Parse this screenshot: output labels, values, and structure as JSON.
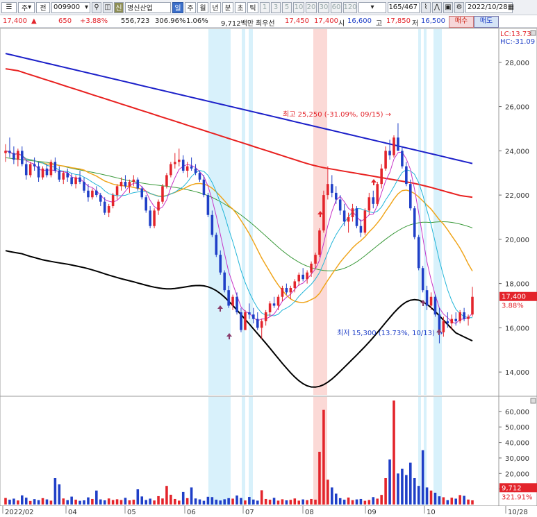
{
  "toolbar": {
    "market": "주",
    "mode": "전",
    "code": "009900",
    "badge": "신",
    "name": "명신산업",
    "periods": [
      "일",
      "주",
      "월",
      "년",
      "분",
      "초",
      "틱"
    ],
    "selected_period": "일",
    "intervals": [
      "1",
      "3",
      "5",
      "10",
      "20",
      "30",
      "60",
      "120"
    ],
    "count": "165",
    "total": "/467",
    "date": "2022/10/28"
  },
  "info": {
    "price": "17,400",
    "change": "650",
    "change_pct": "+3.88%",
    "volume": "556,723",
    "volume_ratio": "306.96%",
    "turnover": "1.06%",
    "amount": "9,712백만",
    "best_quote_label": "최우선",
    "best_ask": "17,450",
    "best_bid": "17,400",
    "open_label": "시",
    "open": "16,600",
    "high_label": "고",
    "high": "17,850",
    "low_label": "저",
    "low": "16,500",
    "buy": "매수",
    "sell": "매도"
  },
  "colors": {
    "up": "#e3242b",
    "down": "#1f3fc7",
    "ma_short": "#c733c7",
    "ma_mid": "#22b5d8",
    "ma_20": "#f0a51c",
    "ma_60": "#3b9a3b",
    "ma_120": "#e8201f",
    "ma_240": "#1c20c9",
    "envelope": "#000000"
  },
  "chart_data": {
    "type": "candlestick",
    "y_axis": {
      "ticks": [
        "28,000",
        "26,000",
        "24,000",
        "22,000",
        "20,000",
        "18,000",
        "16,000",
        "14,000"
      ],
      "range": [
        13000,
        29500
      ]
    },
    "x_axis": {
      "labels": [
        "2022/02",
        "04",
        "05",
        "06",
        "07",
        "08",
        "09",
        "10",
        "10/28"
      ]
    },
    "lc": "LC:13.73",
    "hc": "HC:-31.09",
    "high_annotation": "최고 25,250 (-31.09%, 09/15)",
    "low_annotation": "최저 15,300 (13.73%, 10/13)",
    "last_price": "17,400",
    "last_change": "3.88%",
    "volume_axis": {
      "ticks": [
        "60,000",
        "50,000",
        "40,000",
        "30,000",
        "20,000",
        "10,000"
      ],
      "range": [
        0,
        68000
      ]
    },
    "last_volume": "9,712",
    "last_volume_ratio": "321.91%",
    "candles": [
      [
        23900,
        24300,
        23500,
        24000
      ],
      [
        24000,
        24600,
        23700,
        23900
      ],
      [
        23900,
        24200,
        23400,
        23600
      ],
      [
        23600,
        24100,
        23300,
        24000
      ],
      [
        24000,
        24200,
        23300,
        23400
      ],
      [
        23400,
        23600,
        22700,
        22900
      ],
      [
        22900,
        23500,
        22800,
        23400
      ],
      [
        23400,
        23700,
        23100,
        23300
      ],
      [
        23300,
        23500,
        22600,
        22800
      ],
      [
        22800,
        23300,
        22700,
        23200
      ],
      [
        23200,
        23400,
        22800,
        22900
      ],
      [
        22900,
        23600,
        22800,
        23500
      ],
      [
        23500,
        23700,
        23000,
        23100
      ],
      [
        23100,
        23300,
        22600,
        22700
      ],
      [
        22700,
        23100,
        22500,
        23000
      ],
      [
        23000,
        23200,
        22600,
        22800
      ],
      [
        22800,
        23000,
        22400,
        22500
      ],
      [
        22500,
        22900,
        22300,
        22800
      ],
      [
        22800,
        23100,
        22500,
        22600
      ],
      [
        22600,
        22800,
        22100,
        22200
      ],
      [
        22200,
        22500,
        21700,
        21900
      ],
      [
        21900,
        22300,
        21800,
        22200
      ],
      [
        22200,
        22400,
        21900,
        22000
      ],
      [
        22000,
        22100,
        21500,
        21700
      ],
      [
        21700,
        21900,
        21100,
        21200
      ],
      [
        21200,
        21600,
        21000,
        21500
      ],
      [
        21500,
        22100,
        21400,
        22000
      ],
      [
        22000,
        22500,
        21800,
        22400
      ],
      [
        22400,
        22800,
        22200,
        22600
      ],
      [
        22600,
        22900,
        22300,
        22400
      ],
      [
        22400,
        22700,
        22100,
        22600
      ],
      [
        22600,
        22900,
        22400,
        22700
      ],
      [
        22700,
        22800,
        22200,
        22300
      ],
      [
        22300,
        22400,
        21800,
        21900
      ],
      [
        21900,
        22000,
        21200,
        21300
      ],
      [
        21300,
        21500,
        20500,
        20600
      ],
      [
        20600,
        21400,
        20500,
        21300
      ],
      [
        21300,
        21800,
        21100,
        21700
      ],
      [
        21700,
        22500,
        21600,
        22400
      ],
      [
        22400,
        23000,
        22300,
        22900
      ],
      [
        22900,
        23500,
        22800,
        23400
      ],
      [
        23400,
        23900,
        23200,
        23500
      ],
      [
        23500,
        24100,
        23300,
        23600
      ],
      [
        23600,
        23800,
        23000,
        23100
      ],
      [
        23100,
        23500,
        22800,
        23300
      ],
      [
        23300,
        23700,
        23100,
        23200
      ],
      [
        23200,
        23400,
        22900,
        23000
      ],
      [
        23000,
        23100,
        22600,
        22700
      ],
      [
        22700,
        22900,
        21900,
        22000
      ],
      [
        22000,
        22100,
        21000,
        21100
      ],
      [
        21100,
        21300,
        20100,
        20200
      ],
      [
        20200,
        20300,
        19200,
        19300
      ],
      [
        19300,
        19500,
        18400,
        18500
      ],
      [
        18500,
        18600,
        17600,
        17700
      ],
      [
        17700,
        17900,
        16900,
        17000
      ],
      [
        17000,
        17500,
        16800,
        17400
      ],
      [
        17400,
        17600,
        16600,
        16700
      ],
      [
        16700,
        16900,
        15800,
        15900
      ],
      [
        15900,
        16800,
        15900,
        16700
      ],
      [
        16700,
        17100,
        16400,
        16600
      ],
      [
        16600,
        16900,
        16200,
        16400
      ],
      [
        16400,
        16700,
        15900,
        16000
      ],
      [
        16000,
        16400,
        15500,
        16300
      ],
      [
        16300,
        16800,
        16100,
        16700
      ],
      [
        16700,
        17200,
        16500,
        17100
      ],
      [
        17100,
        17400,
        16900,
        17000
      ],
      [
        17000,
        17500,
        16800,
        17400
      ],
      [
        17400,
        17900,
        17200,
        17800
      ],
      [
        17800,
        18000,
        17500,
        17600
      ],
      [
        17600,
        17900,
        17300,
        17800
      ],
      [
        17800,
        18200,
        17600,
        18100
      ],
      [
        18100,
        18500,
        17900,
        18400
      ],
      [
        18400,
        18700,
        18100,
        18200
      ],
      [
        18200,
        18600,
        18000,
        18500
      ],
      [
        18500,
        19000,
        18300,
        18900
      ],
      [
        18900,
        19400,
        18700,
        19300
      ],
      [
        19300,
        20500,
        19200,
        20400
      ],
      [
        20400,
        22200,
        20300,
        22000
      ],
      [
        22000,
        23300,
        21800,
        22500
      ],
      [
        22500,
        22900,
        21900,
        22100
      ],
      [
        22100,
        22400,
        21600,
        21800
      ],
      [
        21800,
        22000,
        21100,
        21300
      ],
      [
        21300,
        21600,
        20600,
        20800
      ],
      [
        20800,
        21200,
        20300,
        21000
      ],
      [
        21000,
        21600,
        20800,
        21400
      ],
      [
        21400,
        21500,
        20500,
        20600
      ],
      [
        20600,
        20900,
        20100,
        20300
      ],
      [
        20300,
        21400,
        20200,
        21300
      ],
      [
        21300,
        22100,
        21100,
        21900
      ],
      [
        21900,
        22200,
        21400,
        21600
      ],
      [
        21600,
        22600,
        21500,
        22500
      ],
      [
        22500,
        23400,
        22300,
        23200
      ],
      [
        23200,
        24200,
        23100,
        24000
      ],
      [
        24000,
        24500,
        23600,
        23800
      ],
      [
        23800,
        24700,
        23700,
        24600
      ],
      [
        24600,
        25250,
        24400,
        24000
      ],
      [
        24000,
        24200,
        23200,
        23300
      ],
      [
        23300,
        23500,
        22400,
        22500
      ],
      [
        22500,
        22700,
        21300,
        21400
      ],
      [
        21400,
        21500,
        20000,
        20100
      ],
      [
        20100,
        20200,
        18600,
        18700
      ],
      [
        18700,
        18800,
        17600,
        17700
      ],
      [
        17700,
        17900,
        16800,
        17000
      ],
      [
        17000,
        17600,
        16800,
        17400
      ],
      [
        17400,
        17500,
        16500,
        16600
      ],
      [
        16600,
        16900,
        15300,
        15800
      ],
      [
        15800,
        16500,
        15600,
        16300
      ],
      [
        16300,
        16700,
        16000,
        16200
      ],
      [
        16200,
        16600,
        15900,
        16400
      ],
      [
        16400,
        16700,
        16100,
        16300
      ],
      [
        16300,
        16800,
        16200,
        16700
      ],
      [
        16700,
        16900,
        16300,
        16400
      ],
      [
        16400,
        16600,
        16100,
        16500
      ],
      [
        16600,
        17850,
        16500,
        17400
      ]
    ],
    "volumes": [
      4200,
      3100,
      3800,
      2600,
      5900,
      4400,
      2300,
      3500,
      2800,
      4100,
      3300,
      2500,
      17000,
      13000,
      3900,
      2800,
      5100,
      3100,
      2400,
      2700,
      4600,
      3600,
      9000,
      3300,
      2700,
      3900,
      2900,
      3400,
      2900,
      4300,
      2700,
      3100,
      9800,
      5200,
      2900,
      3800,
      2600,
      5400,
      3900,
      12000,
      6300,
      3600,
      2500,
      8100,
      4100,
      11000,
      3900,
      3300,
      2400,
      5000,
      4800,
      3100,
      2600,
      3400,
      4100,
      3800,
      5800,
      4200,
      2600,
      4900,
      3200,
      2500,
      9200,
      3600,
      3100,
      4300,
      2500,
      3400,
      2700,
      3000,
      3900,
      2500,
      3300,
      2800,
      3600,
      3100,
      34000,
      61000,
      16000,
      11000,
      7000,
      4100,
      3100,
      4500,
      2800,
      3300,
      3600,
      2400,
      2900,
      4800,
      3800,
      6200,
      17000,
      29000,
      67000,
      20000,
      23000,
      19000,
      27000,
      17000,
      12000,
      35000,
      11000,
      9000,
      7600,
      5300,
      4700,
      2800,
      4400,
      3800,
      6100,
      5600,
      3200,
      2700,
      3300,
      2800,
      9712
    ]
  }
}
